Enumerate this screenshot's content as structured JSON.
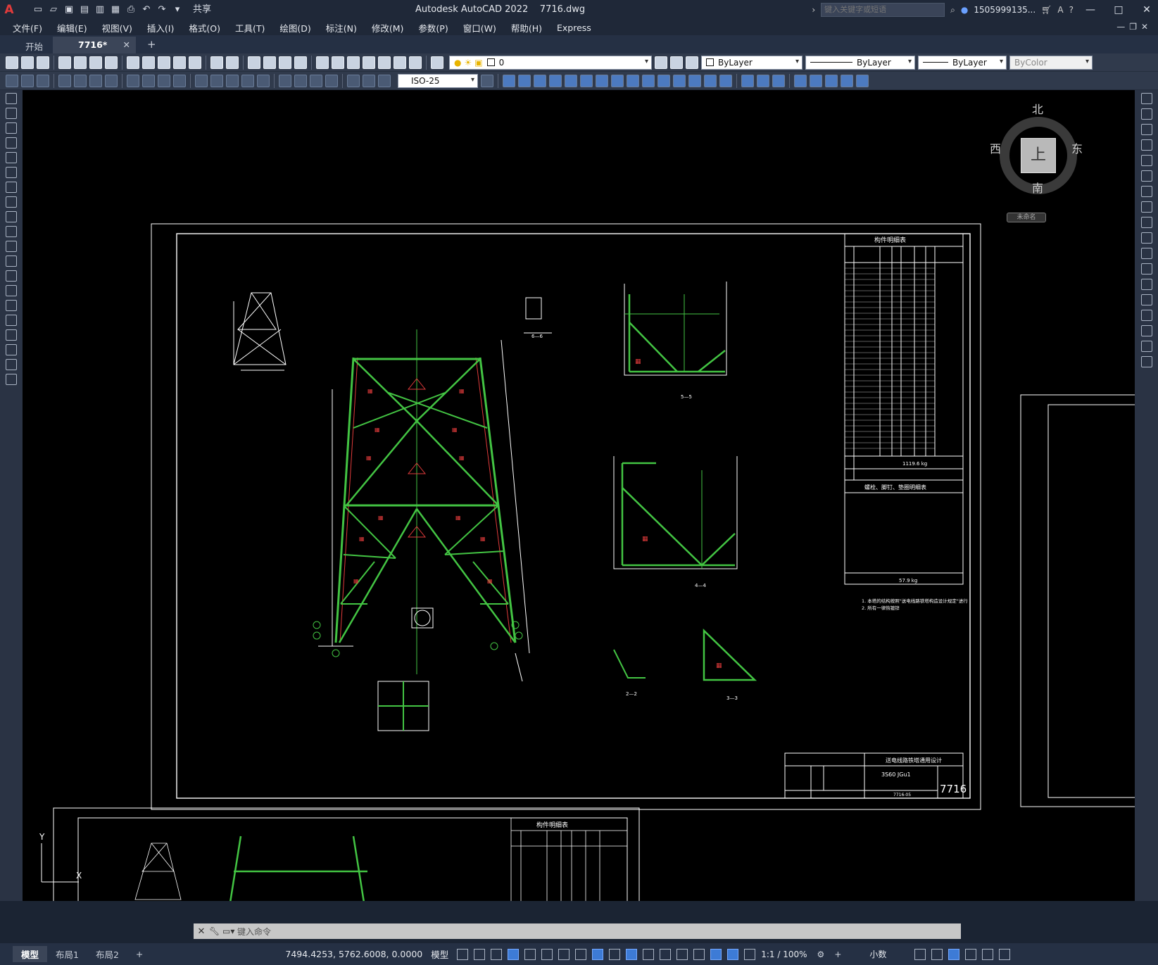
{
  "titlebar": {
    "app_title": "Autodesk AutoCAD 2022    7716.dwg",
    "share_label": "共享",
    "search_placeholder": "键入关键字或短语",
    "user": "1505999135...",
    "logo_letter": "A"
  },
  "menu": [
    "文件(F)",
    "编辑(E)",
    "视图(V)",
    "插入(I)",
    "格式(O)",
    "工具(T)",
    "绘图(D)",
    "标注(N)",
    "修改(M)",
    "参数(P)",
    "窗口(W)",
    "帮助(H)",
    "Express"
  ],
  "tabs": {
    "start": "开始",
    "file": "7716*"
  },
  "properties": {
    "layer": "0",
    "color": "ByLayer",
    "linetype": "ByLayer",
    "lineweight": "ByLayer",
    "plotstyle": "ByColor",
    "dimstyle": "ISO-25"
  },
  "viewcube": {
    "north": "北",
    "south": "南",
    "east": "东",
    "west": "西",
    "top": "上",
    "wcs": "未命名"
  },
  "drawing": {
    "title_block_text": "送电线路铁塔通用设计",
    "drawing_number": "7716",
    "model_id": "3S60 JGu1",
    "drawing_code": "7716-05",
    "parts_table_title": "构件明细表",
    "bolts_table_title": "螺栓、脚钉、垫圈明细表",
    "total_weight": "1119.6 kg",
    "bolt_weight": "57.9 kg",
    "notes": [
      "1. 本塔的结构按照\"送电线路铁塔构造设计规定\"进行",
      "2. 所有一律热镀锌"
    ],
    "section_labels": [
      "6—6",
      "5—5",
      "4—4",
      "2—2",
      "3—3"
    ]
  },
  "command": {
    "placeholder": "键入命令"
  },
  "statusbar": {
    "layouts": [
      "模型",
      "布局1",
      "布局2"
    ],
    "add": "+",
    "coords": "7494.4253, 5762.6008, 0.0000",
    "model": "模型",
    "scale": "1:1 / 100%",
    "units": "小数"
  },
  "ucs": {
    "y": "Y",
    "x": "X"
  }
}
